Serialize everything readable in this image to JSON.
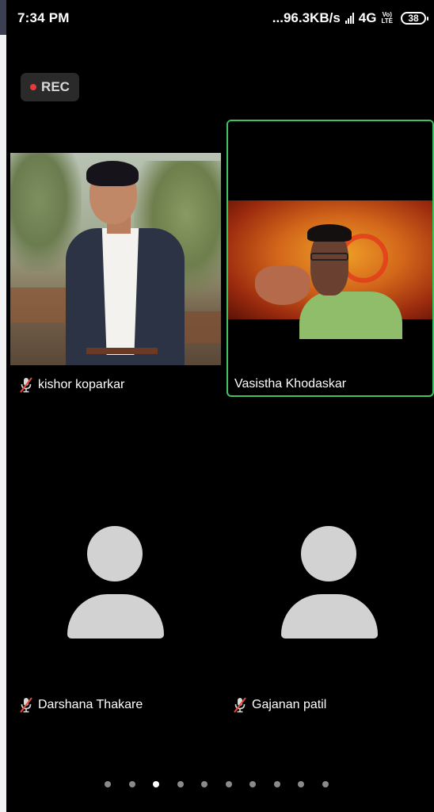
{
  "status_bar": {
    "time": "7:34 PM",
    "speed": "...96.3KB/s",
    "network": "4G",
    "volte_top": "Vo)",
    "volte_bottom": "LTE",
    "battery": "38"
  },
  "recording": {
    "label": "REC",
    "dot_color": "#e83a3a"
  },
  "participants": [
    {
      "name": "kishor koparkar",
      "muted": true,
      "video": true,
      "active_speaker": false
    },
    {
      "name": "Vasistha Khodaskar",
      "muted": false,
      "video": true,
      "active_speaker": true
    },
    {
      "name": "Darshana Thakare",
      "muted": true,
      "video": false,
      "active_speaker": false
    },
    {
      "name": "Gajanan patil",
      "muted": true,
      "video": false,
      "active_speaker": false
    }
  ],
  "colors": {
    "background": "#000000",
    "active_border": "#3fc463",
    "avatar": "#d2d2d2",
    "muted_icon": "#e84a3a"
  },
  "pagination": {
    "total_pages": 10,
    "current_page": 3
  },
  "icons": [
    "signal-bars-icon",
    "battery-icon",
    "record-dot-icon",
    "mic-muted-icon",
    "avatar-placeholder-icon"
  ]
}
